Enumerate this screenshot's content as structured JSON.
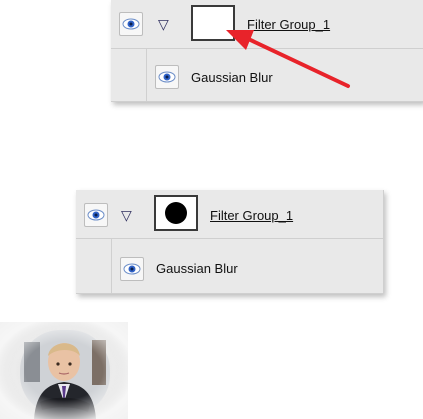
{
  "panels": [
    {
      "group_label": "Filter Group_1",
      "filter_label": "Gaussian Blur"
    },
    {
      "group_label": "Filter Group_1",
      "filter_label": "Gaussian Blur"
    }
  ],
  "colors": {
    "panel_bg": "#e9e9e9",
    "arrow": "#e8232a",
    "eye_iris": "#2f62c8"
  },
  "icons": {
    "visibility": "eye-icon",
    "expand": "triangle-down-icon"
  }
}
